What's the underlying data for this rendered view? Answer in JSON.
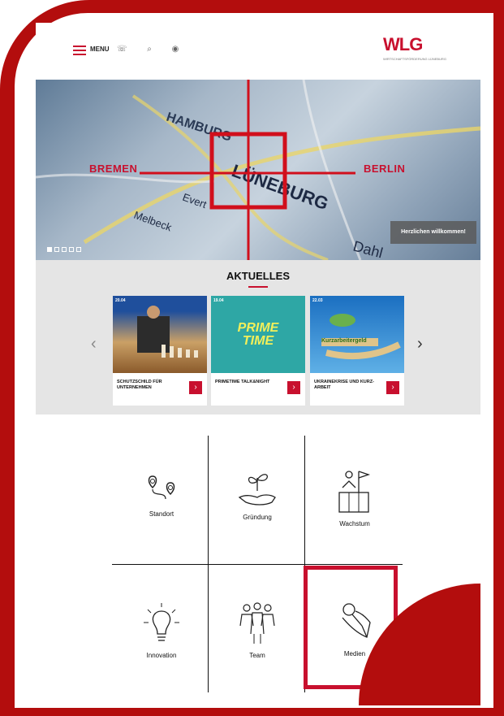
{
  "header": {
    "menu_label": "MENU",
    "logo_text": "WLG",
    "logo_subtitle": "WIRTSCHAFTSFÖRDERUNG LÜNEBURG",
    "icons": [
      "hamburger-icon",
      "search-icon",
      "location-icon",
      "phone-icon"
    ]
  },
  "hero": {
    "city_left": "BREMEN",
    "city_right": "BERLIN",
    "welcome_label": "Herzlichen willkommen!",
    "map_labels": [
      "HAMBURG",
      "LÜNEBURG",
      "Evert",
      "Melbeck",
      "Dahl"
    ],
    "slides": 5,
    "active_slide": 0
  },
  "news": {
    "title": "AKTUELLES",
    "cards": [
      {
        "date": "20.04",
        "title": "SCHUTZSCHILD FÜR UNTERNEHMEN"
      },
      {
        "date": "19.04",
        "title": "PRIMETIME TALK&NIGHT",
        "image_text": "PRIME TIME"
      },
      {
        "date": "22.03",
        "title": "UKRAINEKRISE UND KURZ-ARBEIT",
        "image_text": "Kurzarbeitergeld"
      }
    ]
  },
  "tiles": [
    {
      "label": "Standort",
      "icon": "route-pin-icon"
    },
    {
      "label": "Gründung",
      "icon": "plant-hand-icon"
    },
    {
      "label": "Wachstum",
      "icon": "podium-flag-icon"
    },
    {
      "label": "Innovation",
      "icon": "lightbulb-icon"
    },
    {
      "label": "Team",
      "icon": "team-icon"
    },
    {
      "label": "Medien",
      "icon": "pin-icon"
    }
  ],
  "colors": {
    "accent": "#c8102e",
    "frame": "#b30d0d"
  }
}
